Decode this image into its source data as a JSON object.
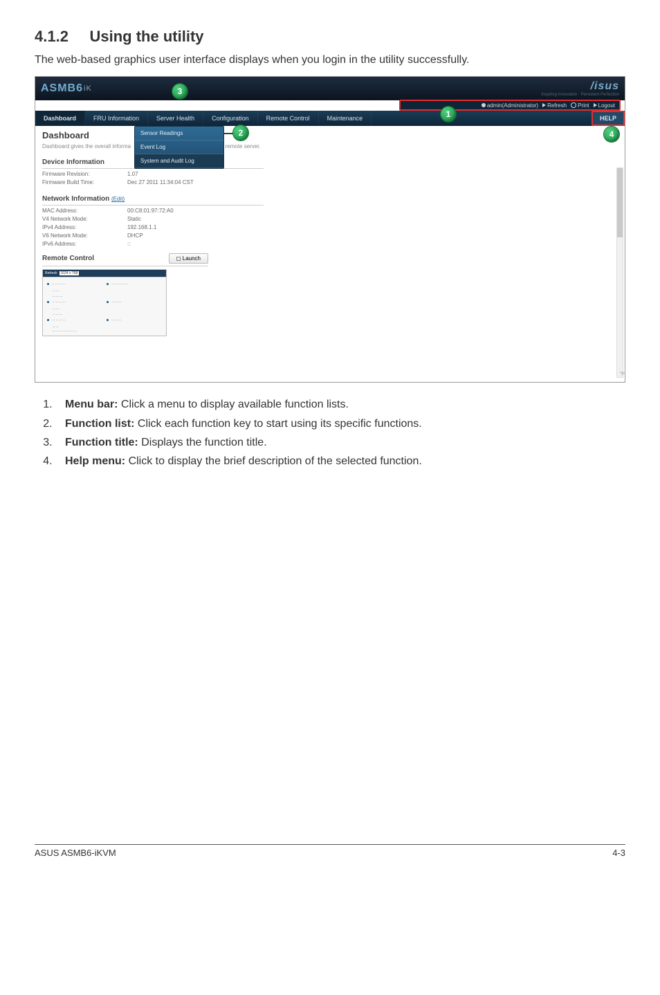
{
  "page": {
    "section_number": "4.1.2",
    "section_title": "Using the utility",
    "intro": "The web-based graphics user interface displays when you login in the utility successfully."
  },
  "branding": {
    "name": "ASMB6",
    "suffix": "iK",
    "logo": "/isus",
    "tagline": "Inspiring Innovation · Persistent Perfection"
  },
  "userbar": {
    "user": "admin(Administrator)",
    "refresh": "Refresh",
    "print": "Print",
    "logout": "Logout"
  },
  "menubar": {
    "items": [
      "Dashboard",
      "FRU Information",
      "Server Health",
      "Configuration",
      "Remote Control",
      "Maintenance"
    ],
    "help": "HELP"
  },
  "dropdown": {
    "items": [
      "Sensor Readings",
      "Event Log",
      "System and Audit Log"
    ]
  },
  "dashboard": {
    "title": "Dashboard",
    "desc_prefix": "Dashboard gives the overall informa",
    "desc_suffix": "he device and remote server.",
    "device_info_head": "Device Information",
    "fw_rev_label": "Firmware Revision:",
    "fw_rev_value": "1.07",
    "fw_build_label": "Firmware Build Time:",
    "fw_build_value": "Dec 27 2011 11:34:04 CST",
    "net_info_head": "Network Information",
    "net_info_link": "(Edit)",
    "mac_label": "MAC Address:",
    "mac_value": "00:C8:01:97:72:A0",
    "v4mode_label": "V4 Network Mode:",
    "v4mode_value": "Static",
    "ipv4_label": "IPv4 Address:",
    "ipv4_value": "192.168.1.1",
    "v6mode_label": "V6 Network Mode:",
    "v6mode_value": "DHCP",
    "ipv6_label": "IPv6 Address:",
    "ipv6_value": "::",
    "remote_head": "Remote Control",
    "launch": "Launch",
    "preview_refresh": "Refresh",
    "preview_res": "1024 x 768"
  },
  "callouts": {
    "c1": "1",
    "c2": "2",
    "c3": "3",
    "c4": "4"
  },
  "notes": {
    "n1_bold": "Menu bar:",
    "n1_rest": " Click a menu to display available function lists.",
    "n2_bold": "Function list:",
    "n2_rest": " Click each function key to start using its specific functions.",
    "n3_bold": "Function title:",
    "n3_rest": " Displays the function title.",
    "n4_bold": "Help menu:",
    "n4_rest": " Click to display the brief description of the selected function."
  },
  "footer": {
    "left": "ASUS ASMB6-iKVM",
    "right": "4-3"
  }
}
